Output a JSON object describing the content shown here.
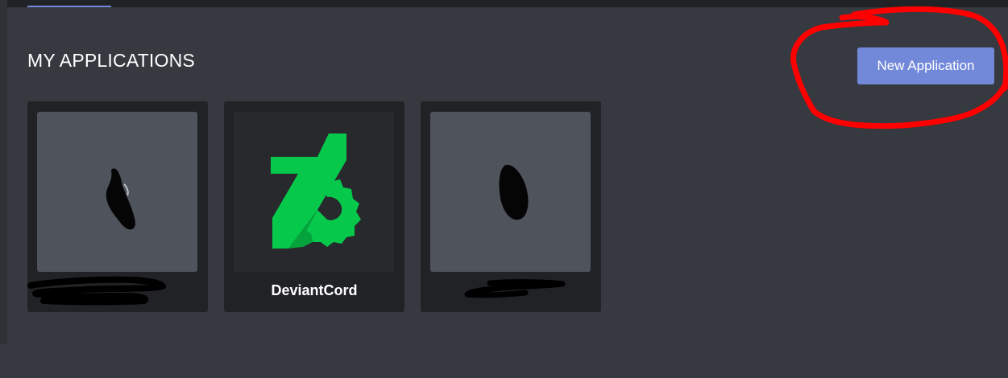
{
  "colors": {
    "background": "#36393f",
    "card": "#202225",
    "accent": "#7289da",
    "logo_green": "#06c94b",
    "annotation_red": "#ff0000"
  },
  "header": {
    "title": "MY APPLICATIONS",
    "new_application_label": "New Application"
  },
  "applications": [
    {
      "name": "",
      "icon": "redacted-avatar",
      "name_redacted": true
    },
    {
      "name": "DeviantCord",
      "icon": "deviantcord-logo",
      "name_redacted": false
    },
    {
      "name": "",
      "icon": "redacted-avatar",
      "name_redacted": true
    }
  ]
}
